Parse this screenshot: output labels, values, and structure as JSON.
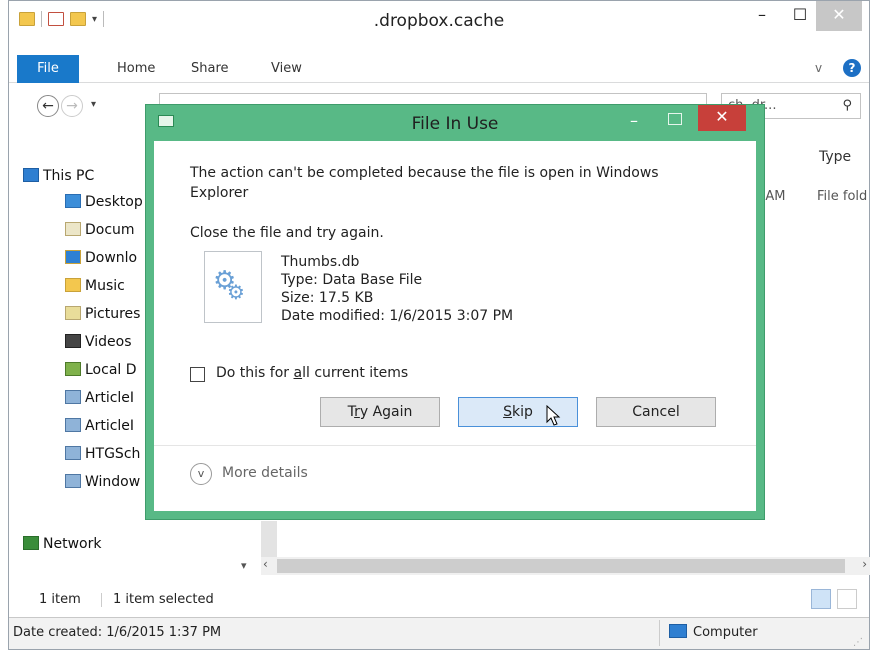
{
  "window": {
    "title": ".dropbox.cache",
    "min_glyph": "–",
    "max_glyph": "☐",
    "close_glyph": "✕"
  },
  "ribbon": {
    "tabs": [
      "File",
      "Home",
      "Share",
      "View"
    ],
    "help_glyph": "?",
    "expand_glyph": "v"
  },
  "nav": {
    "back_glyph": "←",
    "fwd_glyph": "→",
    "drop_glyph": "▾",
    "search_placeholder": "ch .dr...",
    "search_glyph": "⚲"
  },
  "nav_pane": {
    "items": [
      {
        "label": "This PC",
        "icon": "computer-icon"
      },
      {
        "label": "Desktop",
        "icon": "desktop-folder-icon"
      },
      {
        "label": "Docum",
        "icon": "documents-folder-icon"
      },
      {
        "label": "Downlo",
        "icon": "downloads-folder-icon"
      },
      {
        "label": "Music",
        "icon": "music-folder-icon"
      },
      {
        "label": "Pictures",
        "icon": "pictures-folder-icon"
      },
      {
        "label": "Videos",
        "icon": "videos-folder-icon"
      },
      {
        "label": "Local D",
        "icon": "local-disk-icon"
      },
      {
        "label": "ArticleI",
        "icon": "network-drive-icon"
      },
      {
        "label": "ArticleI",
        "icon": "network-drive-icon"
      },
      {
        "label": "HTGSch",
        "icon": "network-drive-icon"
      },
      {
        "label": "Window",
        "icon": "network-drive-icon"
      },
      {
        "label": "Network",
        "icon": "network-icon"
      }
    ]
  },
  "content": {
    "col_type": "Type",
    "row_time": "9 AM",
    "row_type": "File fold"
  },
  "status": {
    "items": "1 item",
    "selected": "1 item selected",
    "date_created": "Date created: 1/6/2015 1:37 PM",
    "location": "Computer"
  },
  "dialog": {
    "title": "File In Use",
    "message": "The action can't be completed because the file is open in Windows Explorer",
    "hint": "Close the file and try again.",
    "file": {
      "name": "Thumbs.db",
      "type": "Type: Data Base File",
      "size": "Size: 17.5 KB",
      "modified": "Date modified: 1/6/2015 3:07 PM"
    },
    "checkbox_pre": "Do this for ",
    "checkbox_key": "a",
    "checkbox_post": "ll current items",
    "try_pre": "T",
    "try_key": "r",
    "try_post": "y Again",
    "skip_key": "S",
    "skip_post": "kip",
    "cancel": "Cancel",
    "more_details": "More details",
    "more_glyph": "v",
    "close_glyph": "✕",
    "min_glyph": "–"
  }
}
